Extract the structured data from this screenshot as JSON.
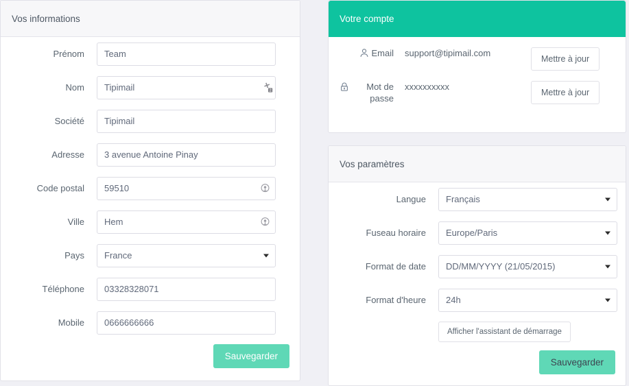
{
  "theme": {
    "page_background": "#f0f0f5",
    "panel_background": "#ffffff",
    "panel_header_background": "#f7f7f9",
    "accent_teal": "#0ec39f",
    "button_mint": "#5fd8b6",
    "text": "#5a6570",
    "border": "#dcdce4"
  },
  "info_panel": {
    "title": "Vos informations",
    "fields": [
      {
        "label": "Prénom",
        "value": "Team",
        "type": "text",
        "icon": null
      },
      {
        "label": "Nom",
        "value": "Tipimail",
        "type": "text",
        "icon": "text-cursor-icon"
      },
      {
        "label": "Société",
        "value": "Tipimail",
        "type": "text",
        "icon": null
      },
      {
        "label": "Adresse",
        "value": "3 avenue Antoine Pinay",
        "type": "text",
        "icon": null
      },
      {
        "label": "Code postal",
        "value": "59510",
        "type": "text",
        "icon": "location-pin-icon"
      },
      {
        "label": "Ville",
        "value": "Hem",
        "type": "text",
        "icon": "location-pin-icon"
      },
      {
        "label": "Pays",
        "value": "France",
        "type": "select",
        "icon": null
      },
      {
        "label": "Téléphone",
        "value": "03328328071",
        "type": "text",
        "icon": null
      },
      {
        "label": "Mobile",
        "value": "0666666666",
        "type": "text",
        "icon": null
      }
    ],
    "save_label": "Sauvegarder"
  },
  "account_panel": {
    "title": "Votre compte",
    "rows": [
      {
        "label": "Email",
        "icon": "user-icon",
        "value": "support@tipimail.com",
        "action_label": "Mettre à jour"
      },
      {
        "label": "Mot de passe",
        "icon": "lock-icon",
        "value": "xxxxxxxxxx",
        "action_label": "Mettre à jour"
      }
    ]
  },
  "params_panel": {
    "title": "Vos paramètres",
    "fields": [
      {
        "label": "Langue",
        "value": "Français"
      },
      {
        "label": "Fuseau horaire",
        "value": "Europe/Paris"
      },
      {
        "label": "Format de date",
        "value": "DD/MM/YYYY (21/05/2015)"
      },
      {
        "label": "Format d'heure",
        "value": "24h"
      }
    ],
    "wizard_button_label": "Afficher l'assistant de démarrage",
    "save_label": "Sauvegarder"
  }
}
